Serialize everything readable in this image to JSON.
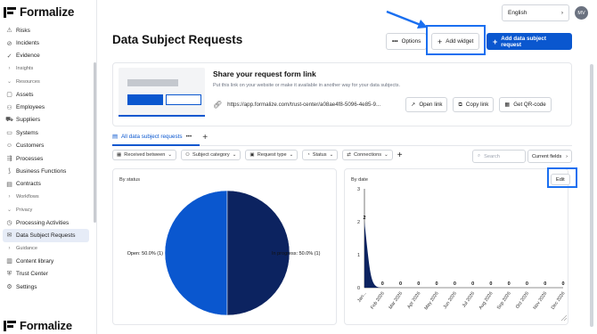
{
  "brand": {
    "name": "Formalize"
  },
  "sidebar": {
    "items": [
      {
        "label": "Risks",
        "icon": "warning-icon",
        "type": "item"
      },
      {
        "label": "Incidents",
        "icon": "alert-icon",
        "type": "item"
      },
      {
        "label": "Evidence",
        "icon": "checkmark-icon",
        "type": "item"
      },
      {
        "label": "Insights",
        "icon": "chevron-right-icon",
        "type": "group"
      },
      {
        "label": "Resources",
        "icon": "chevron-down-icon",
        "type": "group"
      },
      {
        "label": "Assets",
        "icon": "box-icon",
        "type": "item"
      },
      {
        "label": "Employees",
        "icon": "people-icon",
        "type": "item"
      },
      {
        "label": "Suppliers",
        "icon": "truck-icon",
        "type": "item"
      },
      {
        "label": "Systems",
        "icon": "monitor-icon",
        "type": "item"
      },
      {
        "label": "Customers",
        "icon": "user-icon",
        "type": "item"
      },
      {
        "label": "Processes",
        "icon": "flow-icon",
        "type": "item"
      },
      {
        "label": "Business Functions",
        "icon": "function-icon",
        "type": "item"
      },
      {
        "label": "Contracts",
        "icon": "document-icon",
        "type": "item"
      },
      {
        "label": "Workflows",
        "icon": "chevron-right-icon",
        "type": "group"
      },
      {
        "label": "Privacy",
        "icon": "chevron-down-icon",
        "type": "group"
      },
      {
        "label": "Processing Activities",
        "icon": "activity-icon",
        "type": "item"
      },
      {
        "label": "Data Subject Requests",
        "icon": "inbox-icon",
        "type": "item",
        "active": true
      },
      {
        "label": "Guidance",
        "icon": "chevron-right-icon",
        "type": "group"
      },
      {
        "label": "Content library",
        "icon": "book-icon",
        "type": "item"
      },
      {
        "label": "Trust Center",
        "icon": "shield-icon",
        "type": "item"
      },
      {
        "label": "Settings",
        "icon": "gear-icon",
        "type": "item"
      }
    ]
  },
  "header": {
    "title": "Data Subject Requests",
    "language": "English",
    "avatar_initials": "MV",
    "options_label": "Options",
    "add_widget_label": "Add widget",
    "add_request_label": "Add data subject request"
  },
  "share": {
    "title": "Share your request form link",
    "subtitle": "Put this link on your website or make it available in another way for your data subjects.",
    "url": "https://app.formalize.com/trust-center/a08ae4f8-5096-4e85-9...",
    "open_link": "Open link",
    "copy_link": "Copy link",
    "qr_code": "Get QR-code"
  },
  "views": {
    "tab_label": "All data subject requests",
    "more": "•••",
    "add": "+"
  },
  "filters": {
    "items": [
      "Received between",
      "Subject category",
      "Request type",
      "Status",
      "Connections"
    ],
    "add": "+",
    "search_placeholder": "Search",
    "current_fields": "Current fields"
  },
  "widgets": {
    "status_title": "By status",
    "date_title": "By date",
    "edit_label": "Edit"
  },
  "chart_data": [
    {
      "type": "pie",
      "title": "By status",
      "slices": [
        {
          "label": "Open: 50.0% (1)",
          "value": 1,
          "color": "#0a57cf"
        },
        {
          "label": "In progress: 50.0% (1)",
          "value": 1,
          "color": "#0c2360"
        }
      ]
    },
    {
      "type": "area",
      "title": "By date",
      "categories": [
        "Jan 2026",
        "Feb 2026",
        "Mar 2026",
        "Apr 2026",
        "May 2026",
        "Jun 2026",
        "Jul 2026",
        "Aug 2026",
        "Sep 2026",
        "Oct 2026",
        "Nov 2026",
        "Dec 2026"
      ],
      "category_labels": [
        "Jan...",
        "Feb 2026",
        "Mar 2026",
        "Apr 2026",
        "May 2026",
        "Jun 2026",
        "Jul 2026",
        "Aug 2026",
        "Sep 2026",
        "Oct 2026",
        "Nov 2026",
        "Dec 2026"
      ],
      "values": [
        2,
        0,
        0,
        0,
        0,
        0,
        0,
        0,
        0,
        0,
        0,
        0
      ],
      "ylim": [
        0,
        3
      ],
      "yticks": [
        0,
        1,
        2,
        3
      ],
      "color": "#0c2360"
    }
  ]
}
